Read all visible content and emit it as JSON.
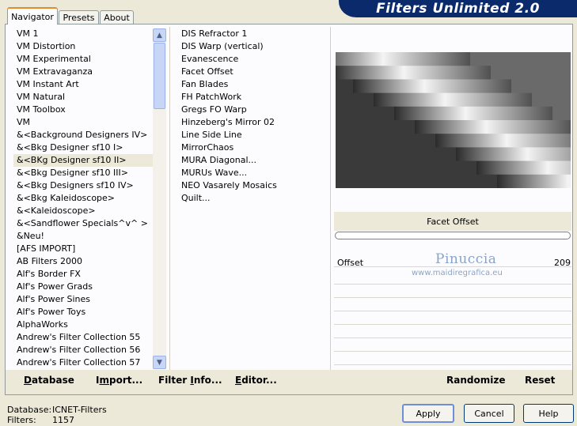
{
  "header": {
    "title": "Filters Unlimited 2.0"
  },
  "tabs": [
    {
      "label": "Navigator",
      "active": true
    },
    {
      "label": "Presets",
      "active": false
    },
    {
      "label": "About",
      "active": false
    }
  ],
  "categories": [
    "VM 1",
    "VM Distortion",
    "VM Experimental",
    "VM Extravaganza",
    "VM Instant Art",
    "VM Natural",
    "VM Toolbox",
    "VM",
    "&<Background Designers IV>",
    "&<Bkg Designer sf10 I>",
    "&<BKg Designer sf10 II>",
    "&<Bkg Designer sf10 III>",
    "&<Bkg Designers sf10 IV>",
    "&<Bkg Kaleidoscope>",
    "&<Kaleidoscope>",
    "&<Sandflower Specials^v^ >",
    "&Neu!",
    "[AFS IMPORT]",
    "AB Filters 2000",
    "Alf's Border FX",
    "Alf's Power Grads",
    "Alf's Power Sines",
    "Alf's Power Toys",
    "AlphaWorks",
    "Andrew's Filter Collection 55",
    "Andrew's Filter Collection 56",
    "Andrew's Filter Collection 57"
  ],
  "selected_category": "&<BKg Designer sf10 II>",
  "effects": [
    "DIS Refractor 1",
    "DIS Warp (vertical)",
    "Evanescence",
    "Facet Offset",
    "Fan Blades",
    "FH PatchWork",
    "Gregs FO Warp",
    "Hinzeberg's Mirror 02",
    "Line Side Line",
    "MirrorChaos",
    "MURA Diagonal...",
    "MURUs Wave...",
    "NEO Vasarely Mosaics",
    "Quilt..."
  ],
  "selected_effect": "Facet Offset",
  "preview": {
    "effect_name": "Facet Offset"
  },
  "parameters": [
    {
      "label": "Offset",
      "value": "209"
    }
  ],
  "watermark": {
    "name": "Pinuccia",
    "url": "www.maidiregrafica.eu"
  },
  "bottom_buttons": {
    "database": {
      "ul": "D",
      "rest": "atabase"
    },
    "import": {
      "pre": "I",
      "ul": "m",
      "rest": "port..."
    },
    "filter_info": {
      "pre": "Filter ",
      "ul": "I",
      "rest": "nfo..."
    },
    "editor": {
      "ul": "E",
      "rest": "ditor..."
    },
    "randomize": "Randomize",
    "reset": "Reset"
  },
  "footer": {
    "database_label": "Database:",
    "database_value": "ICNET-Filters",
    "filters_label": "Filters:",
    "filters_value": "1157",
    "apply": "Apply",
    "cancel": "Cancel",
    "help": "Help"
  },
  "colors": {
    "selection": "#316ac5",
    "banner": "#0a2a6c",
    "tab_accent": "#e68b2c"
  }
}
